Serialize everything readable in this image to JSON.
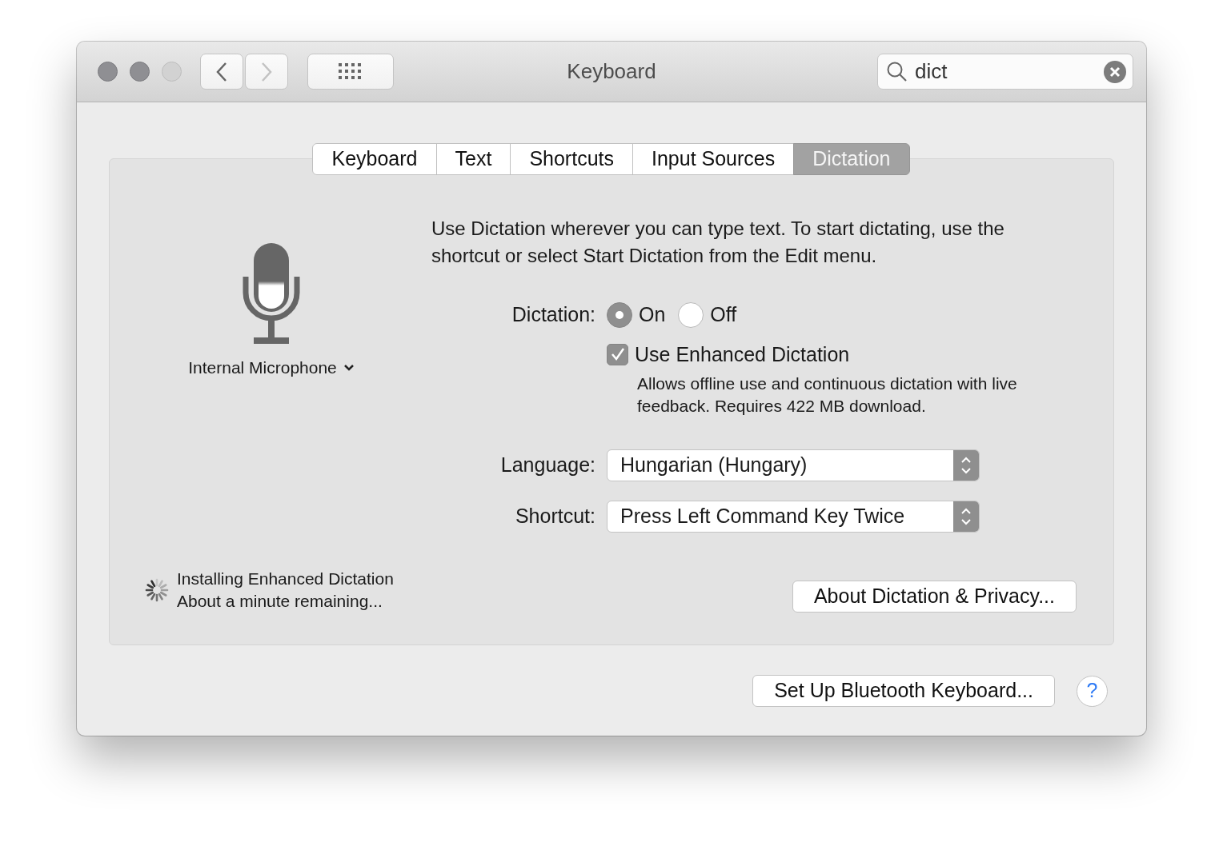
{
  "window": {
    "title": "Keyboard",
    "traffic_lights": [
      {
        "disabled": false
      },
      {
        "disabled": false
      },
      {
        "disabled": true
      }
    ]
  },
  "toolbar": {
    "back": {
      "disabled": false
    },
    "forward": {
      "disabled": true
    }
  },
  "search": {
    "value": "dict"
  },
  "tabs": [
    {
      "label": "Keyboard",
      "selected": false
    },
    {
      "label": "Text",
      "selected": false
    },
    {
      "label": "Shortcuts",
      "selected": false
    },
    {
      "label": "Input Sources",
      "selected": false
    },
    {
      "label": "Dictation",
      "selected": true
    }
  ],
  "microphone": {
    "label": "Internal Microphone"
  },
  "description": "Use Dictation wherever you can type text. To start dictating, use the shortcut or select Start Dictation from the Edit menu.",
  "dictation": {
    "label": "Dictation:",
    "options": [
      {
        "label": "On",
        "selected": true
      },
      {
        "label": "Off",
        "selected": false
      }
    ]
  },
  "enhanced": {
    "label": "Use Enhanced Dictation",
    "checked": true,
    "note": "Allows offline use and continuous dictation with live feedback. Requires 422 MB download."
  },
  "popups": [
    {
      "label": "Language:",
      "value": "Hungarian (Hungary)"
    },
    {
      "label": "Shortcut:",
      "value": "Press Left Command Key Twice"
    }
  ],
  "status": {
    "title": "Installing Enhanced Dictation",
    "detail": "About a minute remaining..."
  },
  "about_button": "About Dictation & Privacy...",
  "bluetooth_button": "Set Up Bluetooth Keyboard...",
  "help_button": "?"
}
